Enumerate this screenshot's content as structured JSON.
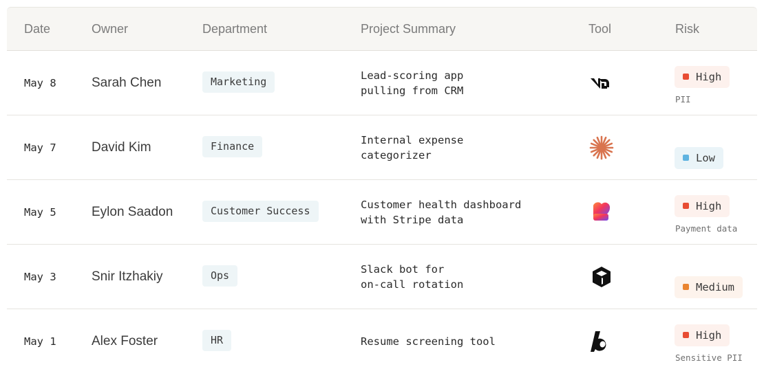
{
  "columns": {
    "date": "Date",
    "owner": "Owner",
    "department": "Department",
    "summary": "Project Summary",
    "tool": "Tool",
    "risk": "Risk"
  },
  "rows": [
    {
      "date": "May 8",
      "owner": "Sarah Chen",
      "department": "Marketing",
      "summary": [
        "Lead-scoring app",
        "pulling from CRM"
      ],
      "tool_icon": "v0-logo-icon",
      "risk": "High",
      "risk_level": "high",
      "risk_note": "PII"
    },
    {
      "date": "May 7",
      "owner": "David Kim",
      "department": "Finance",
      "summary": [
        "Internal expense",
        "categorizer"
      ],
      "tool_icon": "claude-starburst-icon",
      "risk": "Low",
      "risk_level": "low",
      "risk_note": ""
    },
    {
      "date": "May 5",
      "owner": "Eylon Saadon",
      "department": "Customer Success",
      "summary": [
        "Customer health dashboard",
        "with Stripe data"
      ],
      "tool_icon": "lovable-heart-icon",
      "risk": "High",
      "risk_level": "high",
      "risk_note": "Payment data"
    },
    {
      "date": "May 3",
      "owner": "Snir Itzhakiy",
      "department": "Ops",
      "summary": [
        "Slack bot for",
        "on-call rotation"
      ],
      "tool_icon": "cube-logo-icon",
      "risk": "Medium",
      "risk_level": "medium",
      "risk_note": ""
    },
    {
      "date": "May 1",
      "owner": "Alex Foster",
      "department": "HR",
      "summary": [
        "Resume screening tool"
      ],
      "tool_icon": "bolt-b-logo-icon",
      "risk": "High",
      "risk_level": "high",
      "risk_note": "Sensitive PII"
    }
  ],
  "colors": {
    "header_bg": "#f7f6f3",
    "dept_chip_bg": "#eef5f7",
    "risk_high": "#e84c33",
    "risk_low": "#5fb3e0",
    "risk_medium": "#ea8430"
  }
}
